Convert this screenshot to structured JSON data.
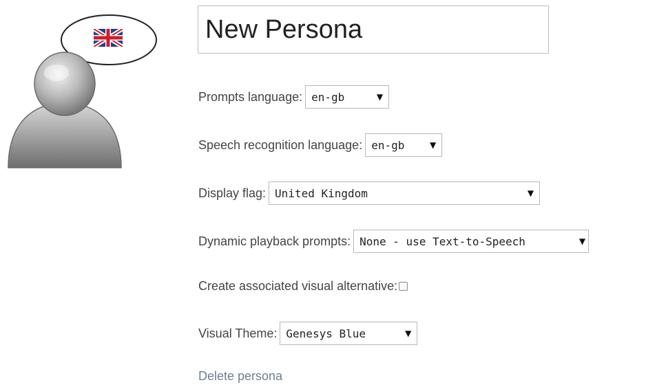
{
  "persona": {
    "name": "New Persona",
    "flag_icon": "uk-flag-icon",
    "avatar_icon": "person-silhouette-icon"
  },
  "fields": {
    "prompts_language": {
      "label": "Prompts language:",
      "value": "en-gb"
    },
    "speech_recognition_language": {
      "label": "Speech recognition language:",
      "value": "en-gb"
    },
    "display_flag": {
      "label": "Display flag:",
      "value": "United Kingdom"
    },
    "dynamic_playback_prompts": {
      "label": "Dynamic playback prompts:",
      "value": "None - use Text-to-Speech"
    },
    "visual_alternative": {
      "label": "Create associated visual alternative:",
      "checked": false
    },
    "visual_theme": {
      "label": "Visual Theme:",
      "value": "Genesys Blue"
    }
  },
  "actions": {
    "delete_label": "Delete persona"
  },
  "colors": {
    "link": "#6b7f93",
    "border": "#b8b8b8",
    "text": "#444444"
  }
}
